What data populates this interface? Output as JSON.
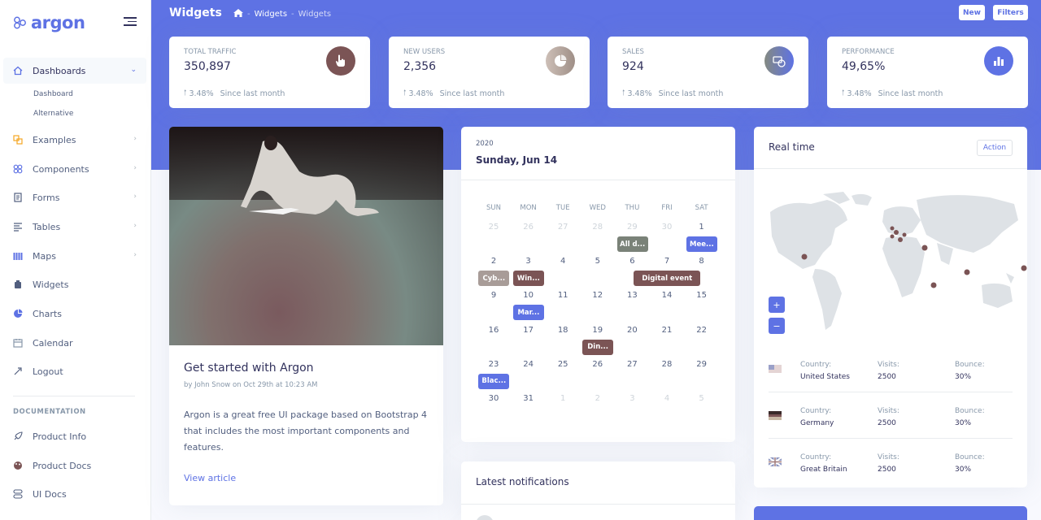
{
  "brand": {
    "name": "argon"
  },
  "sidebar": {
    "items": [
      {
        "label": "Dashboards",
        "icon": "home-icon"
      },
      {
        "label": "Examples",
        "icon": "ungroup-icon"
      },
      {
        "label": "Components",
        "icon": "components-icon"
      },
      {
        "label": "Forms",
        "icon": "forms-icon"
      },
      {
        "label": "Tables",
        "icon": "tables-icon"
      },
      {
        "label": "Maps",
        "icon": "maps-icon"
      },
      {
        "label": "Widgets",
        "icon": "widgets-icon"
      },
      {
        "label": "Charts",
        "icon": "charts-icon"
      },
      {
        "label": "Calendar",
        "icon": "calendar-icon"
      },
      {
        "label": "Logout",
        "icon": "logout-icon"
      }
    ],
    "subitems": [
      "Dashboard",
      "Alternative"
    ],
    "doc_heading": "DOCUMENTATION",
    "doc_items": [
      {
        "label": "Product Info",
        "icon": "spaceship-icon"
      },
      {
        "label": "Product Docs",
        "icon": "palette-icon"
      },
      {
        "label": "UI Docs",
        "icon": "ui-docs-icon"
      }
    ]
  },
  "header": {
    "title": "Widgets",
    "breadcrumb": [
      "Widgets",
      "Widgets"
    ],
    "buttons": {
      "new": "New",
      "filters": "Filters"
    }
  },
  "stats": [
    {
      "label": "TOTAL TRAFFIC",
      "value": "350,897",
      "pct": "3.48%",
      "since": "Since last month",
      "icon": "hand-pointer-icon"
    },
    {
      "label": "NEW USERS",
      "value": "2,356",
      "pct": "3.48%",
      "since": "Since last month",
      "icon": "pie-chart-icon"
    },
    {
      "label": "SALES",
      "value": "924",
      "pct": "3.48%",
      "since": "Since last month",
      "icon": "money-coins-icon"
    },
    {
      "label": "PERFORMANCE",
      "value": "49,65%",
      "pct": "3.48%",
      "since": "Since last month",
      "icon": "bar-chart-icon"
    }
  ],
  "blog": {
    "title": "Get started with Argon",
    "byline": "by John Snow on Oct 29th at 10:23 AM",
    "text": "Argon is a great free UI package based on Bootstrap 4 that includes the most important components and features.",
    "link": "View article"
  },
  "calendar": {
    "year": "2020",
    "date": "Sunday, Jun 14",
    "dow": [
      "SUN",
      "MON",
      "TUE",
      "WED",
      "THU",
      "FRI",
      "SAT"
    ],
    "weeks": [
      [
        "25",
        "26",
        "27",
        "28",
        "29",
        "30",
        "1"
      ],
      [
        "2",
        "3",
        "4",
        "5",
        "6",
        "7",
        "8"
      ],
      [
        "9",
        "10",
        "11",
        "12",
        "13",
        "14",
        "15"
      ],
      [
        "16",
        "17",
        "18",
        "19",
        "20",
        "21",
        "22"
      ],
      [
        "23",
        "24",
        "25",
        "26",
        "27",
        "28",
        "29"
      ],
      [
        "30",
        "31",
        "1",
        "2",
        "3",
        "4",
        "5"
      ]
    ],
    "events": [
      {
        "label": "All d...",
        "color": "#7a8278"
      },
      {
        "label": "Mee...",
        "color": "#5e72e4"
      },
      {
        "label": "Cyb...",
        "color": "#a89c98"
      },
      {
        "label": "Win...",
        "color": "#7b5455"
      },
      {
        "label": "Digital event",
        "color": "#7b5455"
      },
      {
        "label": "Mar...",
        "color": "#5e72e4"
      },
      {
        "label": "Din...",
        "color": "#7b5455"
      },
      {
        "label": "Blac...",
        "color": "#5e72e4"
      }
    ]
  },
  "realtime": {
    "title": "Real time",
    "action": "Action",
    "zoom_in": "+",
    "zoom_out": "−",
    "rows": [
      {
        "country": "United States",
        "visits": "2500",
        "bounce": "30%",
        "flag": "us-flag-icon"
      },
      {
        "country": "Germany",
        "visits": "2500",
        "bounce": "30%",
        "flag": "de-flag-icon"
      },
      {
        "country": "Great Britain",
        "visits": "2500",
        "bounce": "30%",
        "flag": "gb-flag-icon"
      }
    ],
    "labels": {
      "country": "Country:",
      "visits": "Visits:",
      "bounce": "Bounce:"
    }
  },
  "notifications": {
    "title": "Latest notifications"
  },
  "colors": {
    "primary": "#5e72e4",
    "brown": "#7b5455"
  }
}
